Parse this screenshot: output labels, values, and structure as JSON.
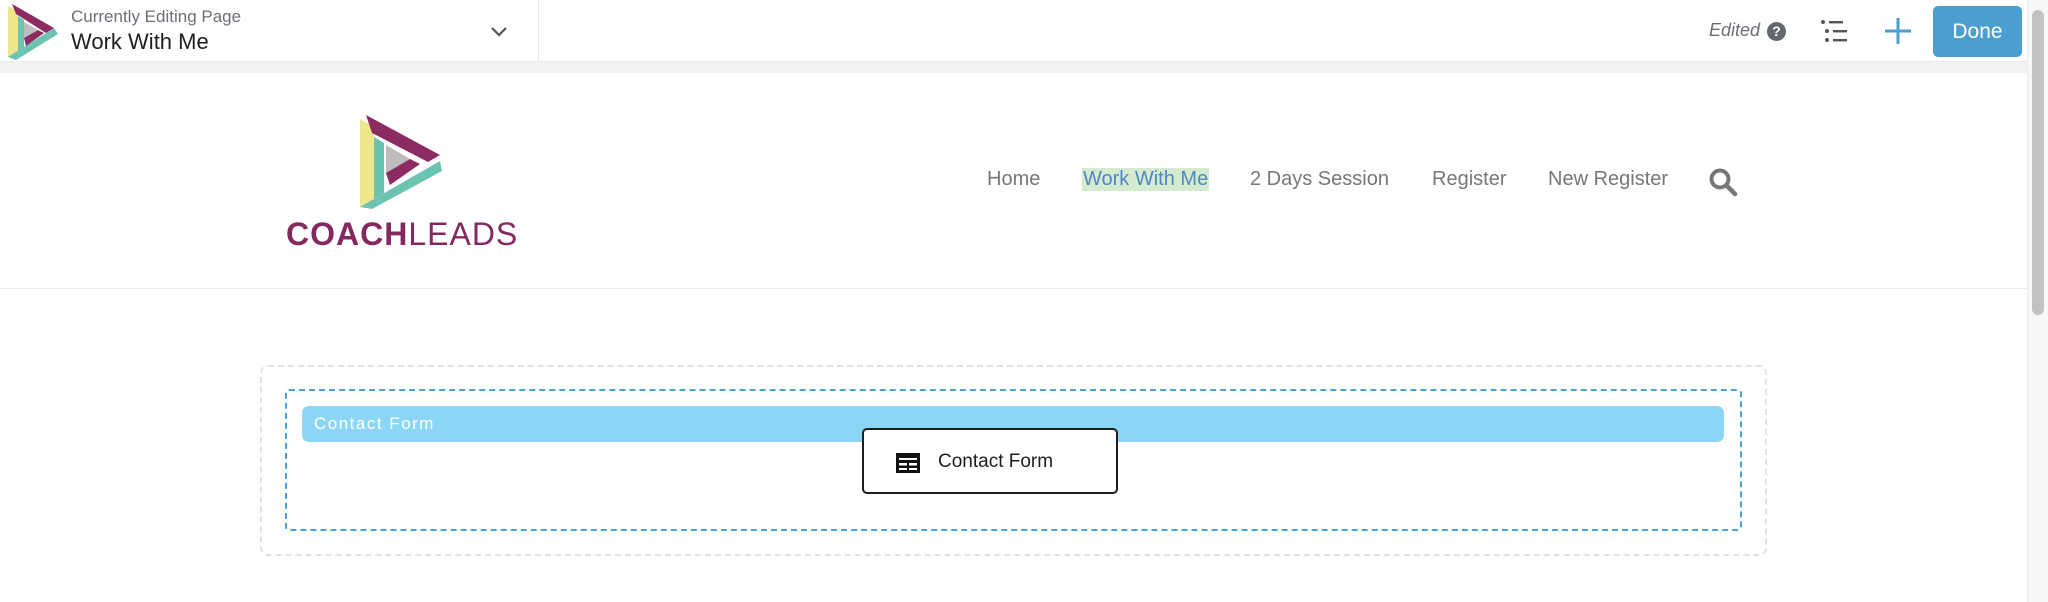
{
  "editor": {
    "eyebrow": "Currently Editing Page",
    "page_title": "Work With Me",
    "status": "Edited",
    "help_glyph": "?",
    "done_label": "Done",
    "icons": [
      "app-logo-icon",
      "chevron-down-icon",
      "help-icon",
      "outline-list-icon",
      "plus-icon"
    ],
    "accent_color": "#4a9fd0"
  },
  "site": {
    "brand_bold": "COACH",
    "brand_light": "LEADS",
    "brand_color": "#842960",
    "nav": [
      {
        "label": "Home",
        "active": false
      },
      {
        "label": "Work With Me",
        "active": true
      },
      {
        "label": "2 Days Session",
        "active": false
      },
      {
        "label": "Register",
        "active": false
      },
      {
        "label": "New Register",
        "active": false
      }
    ],
    "search_icon": "search-icon"
  },
  "content": {
    "block_header": "Contact Form",
    "block_chip_label": "Contact Form",
    "block_chip_icon": "table-icon",
    "block_header_color": "#8bd5f7"
  }
}
